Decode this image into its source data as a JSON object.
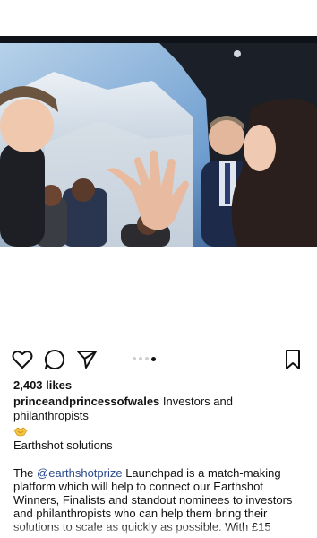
{
  "post": {
    "likes": "2,403 likes",
    "username": "princeandprincessofwales",
    "caption_title": "Investors and philanthropists",
    "emoji": "handshake-emoji",
    "subtitle": "Earthshot solutions",
    "body_prefix": "The ",
    "body_mention": "@earthshotprize",
    "body_rest": " Launchpad is a match-making platform which will help to connect our Earthshot Winners, Finalists and standout nominees to investors and philanthropists who can help them bring their solutions to scale as quickly as possible. With £15",
    "carousel": {
      "count": 4,
      "active_index": 3
    }
  },
  "icons": {
    "like": "heart-icon",
    "comment": "comment-icon",
    "share": "send-icon",
    "save": "bookmark-icon"
  },
  "colors": {
    "mention": "#2b4a8b",
    "carousel_active": "#111111",
    "carousel_inactive": "#cfcfcf"
  }
}
